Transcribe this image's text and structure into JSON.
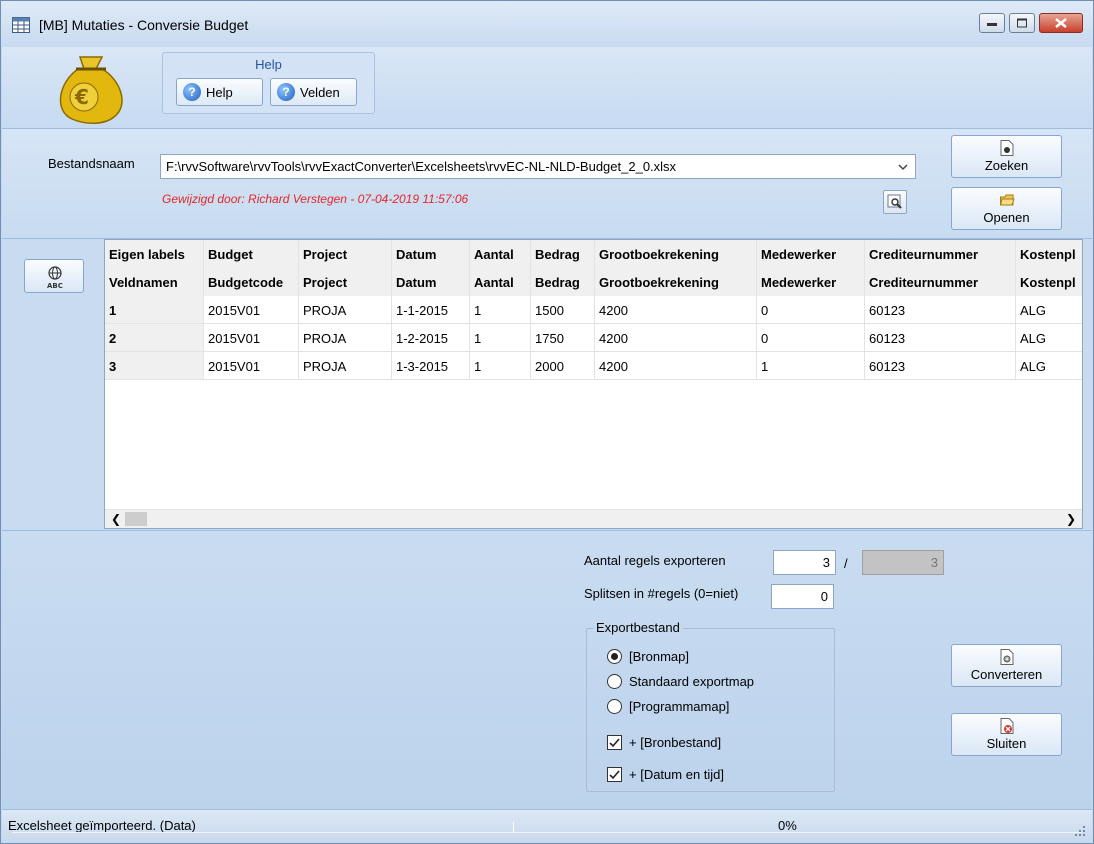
{
  "window": {
    "title": "[MB]  Mutaties - Conversie Budget"
  },
  "ribbon": {
    "group_label": "Help",
    "help_button": "Help",
    "fields_button": "Velden"
  },
  "file": {
    "label": "Bestandsnaam",
    "path": "F:\\rvvSoftware\\rvvTools\\rvvExactConverter\\Excelsheets\\rvvEC-NL-NLD-Budget_2_0.xlsx",
    "modified_by": "Gewijzigd door: Richard Verstegen   -   07-04-2019  11:57:06",
    "search_button": "Zoeken",
    "open_button": "Openen"
  },
  "grid": {
    "header_row1": [
      "Eigen labels",
      "Budget",
      "Project",
      "Datum",
      "Aantal",
      "Bedrag",
      "Grootboekrekening",
      "Medewerker",
      "Crediteurnummer",
      "Kostenpl"
    ],
    "header_row2": [
      "Veldnamen",
      "Budgetcode",
      "Project",
      "Datum",
      "Aantal",
      "Bedrag",
      "Grootboekrekening",
      "Medewerker",
      "Crediteurnummer",
      "Kostenpl"
    ],
    "rows": [
      [
        "1",
        "2015V01",
        "PROJA",
        "1-1-2015",
        "1",
        "1500",
        "4200",
        "0",
        "60123",
        "ALG"
      ],
      [
        "2",
        "2015V01",
        "PROJA",
        "1-2-2015",
        "1",
        "1750",
        "4200",
        "0",
        "60123",
        "ALG"
      ],
      [
        "3",
        "2015V01",
        "PROJA",
        "1-3-2015",
        "1",
        "2000",
        "4200",
        "1",
        "60123",
        "ALG"
      ]
    ]
  },
  "export": {
    "rows_label": "Aantal regels exporteren",
    "rows_value": "3",
    "slash": "/",
    "rows_total": "3",
    "split_label": "Splitsen in #regels (0=niet)",
    "split_value": "0",
    "group_label": "Exportbestand",
    "radio_source": "[Bronmap]",
    "radio_default": "Standaard exportmap",
    "radio_program": "[Programmamap]",
    "check_source_file": "+ [Bronbestand]",
    "check_datetime": "+ [Datum en tijd]",
    "convert_button": "Converteren",
    "close_button": "Sluiten"
  },
  "status": {
    "text": "Excelsheet geïmporteerd. (Data)",
    "progress": "0%"
  },
  "colors": {
    "accent": "#24549e",
    "modified_text": "#e8262a",
    "close_button": "#c7402b"
  }
}
